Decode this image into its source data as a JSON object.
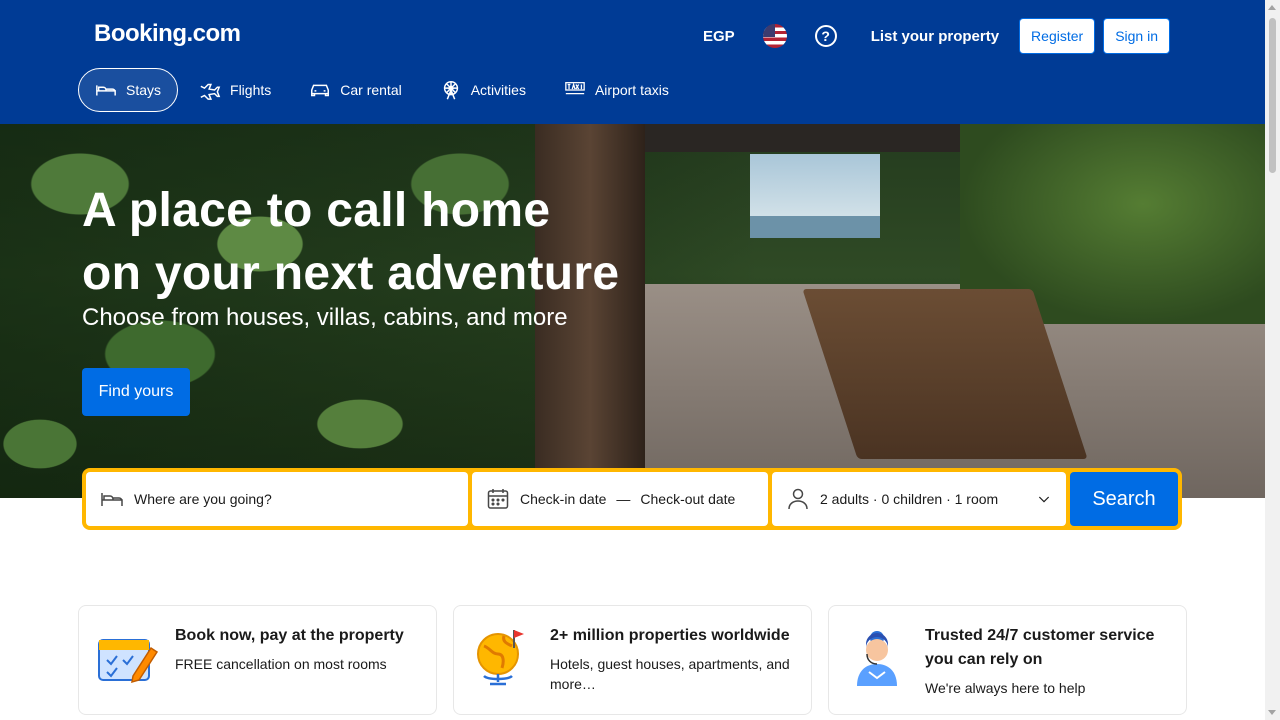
{
  "header": {
    "logo": "Booking.com",
    "currency": "EGP",
    "list_property": "List your property",
    "register": "Register",
    "sign_in": "Sign in",
    "help_icon": "?"
  },
  "nav": {
    "tabs": [
      {
        "label": "Stays",
        "icon": "bed-icon",
        "active": true
      },
      {
        "label": "Flights",
        "icon": "plane-icon",
        "active": false
      },
      {
        "label": "Car rental",
        "icon": "car-icon",
        "active": false
      },
      {
        "label": "Activities",
        "icon": "ferris-wheel-icon",
        "active": false
      },
      {
        "label": "Airport taxis",
        "icon": "taxi-icon",
        "active": false
      }
    ]
  },
  "hero": {
    "title_line1": "A place to call home",
    "title_line2": "on your next adventure",
    "subtitle": "Choose from houses, villas, cabins, and more",
    "cta": "Find yours"
  },
  "search": {
    "destination_placeholder": "Where are you going?",
    "checkin": "Check-in date",
    "dash": "—",
    "checkout": "Check-out date",
    "occupancy": "2 adults · 0 children · 1 room",
    "button": "Search"
  },
  "cards": [
    {
      "title": "Book now, pay at the property",
      "text": "FREE cancellation on most rooms"
    },
    {
      "title": "2+ million properties worldwide",
      "text": "Hotels, guest houses, apartments, and more…"
    },
    {
      "title": "Trusted 24/7 customer service you can rely on",
      "text": "We're always here to help"
    }
  ],
  "colors": {
    "brand_blue": "#003b95",
    "action_blue": "#006ce4",
    "accent_yellow": "#ffb700"
  }
}
